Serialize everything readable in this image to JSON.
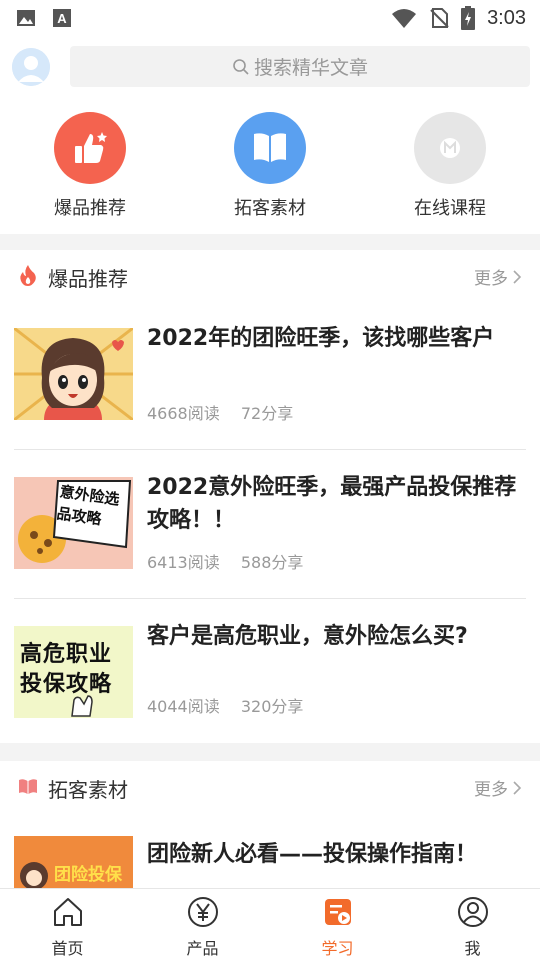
{
  "status_bar": {
    "time": "3:03"
  },
  "search": {
    "placeholder": "搜索精华文章"
  },
  "quick_entries": [
    {
      "label": "爆品推荐",
      "icon": "thumbs-up-icon",
      "color": "#f4634f"
    },
    {
      "label": "拓客素材",
      "icon": "book-icon",
      "color": "#5aa0f0"
    },
    {
      "label": "在线课程",
      "icon": "course-icon",
      "color": "#e6e6e6"
    }
  ],
  "sections": [
    {
      "title": "爆品推荐",
      "icon": "fire-icon",
      "more": "更多",
      "articles": [
        {
          "title": "2022年的团险旺季，该找哪些客户",
          "reads": "4668阅读",
          "shares": "72分享",
          "thumb": "cartoon-girl-thumbnail"
        },
        {
          "title": "2022意外险旺季，最强产品投保推荐攻略！！",
          "reads": "6413阅读",
          "shares": "588分享",
          "thumb_text": "意外险选品攻略"
        },
        {
          "title": "客户是高危职业，意外险怎么买?",
          "reads": "4044阅读",
          "shares": "320分享",
          "thumb_text": "高危职业投保攻略"
        }
      ]
    },
    {
      "title": "拓客素材",
      "icon": "open-book-icon",
      "more": "更多",
      "articles": [
        {
          "title": "团险新人必看——投保操作指南！",
          "thumb_text": "团险投保"
        }
      ]
    }
  ],
  "tabs": [
    {
      "label": "首页",
      "icon": "home-icon",
      "active": false
    },
    {
      "label": "产品",
      "icon": "yen-icon",
      "active": false
    },
    {
      "label": "学习",
      "icon": "study-icon",
      "active": true
    },
    {
      "label": "我",
      "icon": "user-icon",
      "active": false
    }
  ],
  "colors": {
    "accent": "#f26b2b",
    "text": "#222222",
    "muted": "#999999"
  }
}
